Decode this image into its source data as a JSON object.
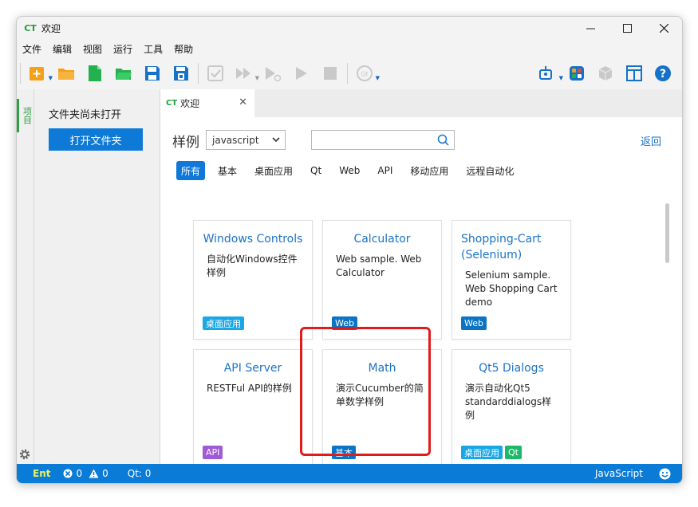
{
  "window": {
    "title": "欢迎",
    "logo_text": "CT"
  },
  "menu": [
    "文件",
    "编辑",
    "视图",
    "运行",
    "工具",
    "帮助"
  ],
  "activity": {
    "project_tab_label": "项目"
  },
  "explorer": {
    "no_folder_message": "文件夹尚未打开",
    "open_folder_label": "打开文件夹"
  },
  "tab": {
    "label": "欢迎",
    "logo_text": "CT",
    "close_glyph": "✕"
  },
  "samples": {
    "label": "样例",
    "language_selected": "javascript",
    "search_placeholder": "",
    "back_label": "返回",
    "filters": [
      {
        "label": "所有",
        "active": true
      },
      {
        "label": "基本",
        "active": false
      },
      {
        "label": "桌面应用",
        "active": false
      },
      {
        "label": "Qt",
        "active": false
      },
      {
        "label": "Web",
        "active": false
      },
      {
        "label": "API",
        "active": false
      },
      {
        "label": "移动应用",
        "active": false
      },
      {
        "label": "远程自动化",
        "active": false
      }
    ],
    "cards": [
      {
        "title": "Windows Controls",
        "desc": "自动化Windows控件样例",
        "tags": [
          "桌面应用"
        ]
      },
      {
        "title": "Calculator",
        "desc": "Web sample. Web Calculator",
        "tags": [
          "Web"
        ]
      },
      {
        "title": "Shopping-Cart (Selenium)",
        "desc": "Selenium sample. Web Shopping Cart demo",
        "tags": [
          "Web"
        ]
      },
      {
        "title": "API Server",
        "desc": "RESTFul API的样例",
        "tags": [
          "API"
        ]
      },
      {
        "title": "Math",
        "desc": "演示Cucumber的简单数学样例",
        "tags": [
          "基本"
        ]
      },
      {
        "title": "Qt5 Dialogs",
        "desc": "演示自动化Qt5 standarddialogs样例",
        "tags": [
          "桌面应用",
          "Qt"
        ]
      }
    ]
  },
  "tag_colors": {
    "桌面应用": "#1aa7e6",
    "Web": "#0b74c4",
    "API": "#a05ad6",
    "基本": "#0b74c4",
    "Qt": "#1fb76a"
  },
  "status": {
    "ent": "Ent",
    "errors": "0",
    "warnings": "0",
    "qt": "Qt: 0",
    "language": "JavaScript"
  },
  "colors": {
    "accent": "#0a7bd7",
    "brand_green": "#1f9e3c",
    "highlight": "#e01b1b"
  }
}
